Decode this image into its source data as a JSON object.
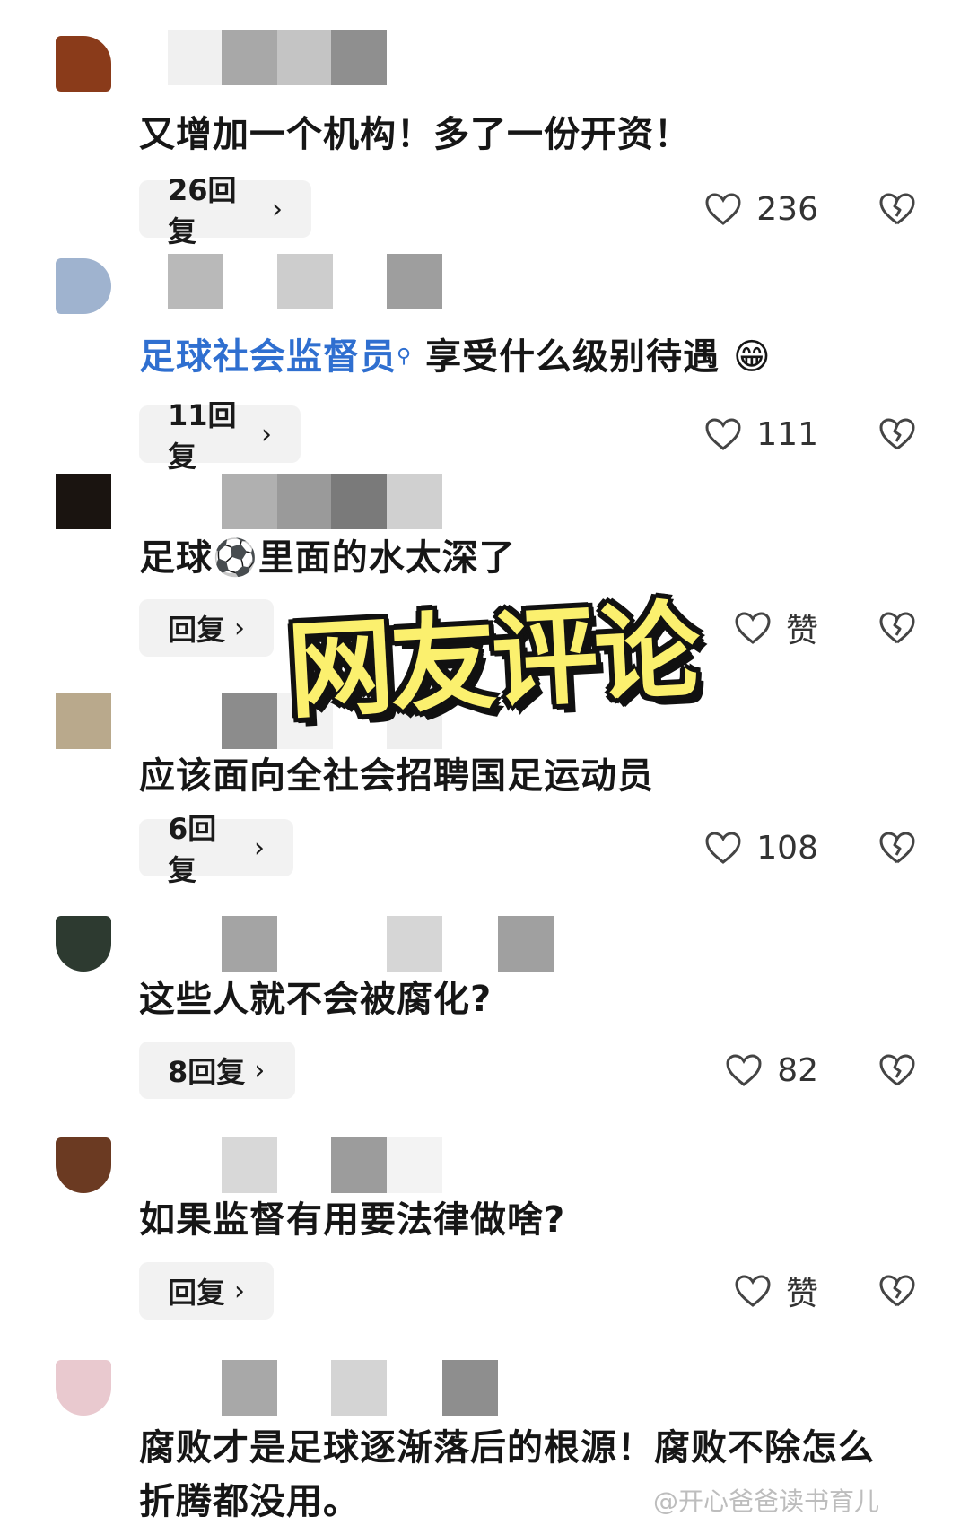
{
  "comments": [
    {
      "text": "又增加一个机构！多了一份开资！",
      "reply_label": "26回复",
      "like_label": "236",
      "avatar_color": "#8a3b1a"
    },
    {
      "text_link": "足球社会监督员",
      "text_rest": "享受什么级别待遇",
      "reply_label": "11回复",
      "like_label": "111",
      "avatar_color": "#9fb3cf"
    },
    {
      "text_a": "足球",
      "text_b": "里面的水太深了",
      "reply_label": "回复",
      "like_label": "赞",
      "avatar_color": "#1a1410"
    },
    {
      "text": "应该面向全社会招聘国足运动员",
      "reply_label": "6回复",
      "like_label": "108",
      "avatar_color": "#b9a98c"
    },
    {
      "text": "这些人就不会被腐化?",
      "reply_label": "8回复",
      "like_label": "82",
      "avatar_color": "#2d3a30"
    },
    {
      "text": "如果监督有用要法律做啥?",
      "reply_label": "回复",
      "like_label": "赞",
      "avatar_color": "#6b3a22"
    },
    {
      "text_line1": "腐败才是足球逐渐落后的根源！腐败不除怎么",
      "text_line2": "折腾都没用。",
      "avatar_color": "#e9c9cf"
    }
  ],
  "overlay_title": "网友评论",
  "watermark": "@开心爸爸读书育儿",
  "icons": {
    "like": "heart-icon",
    "dislike": "broken-heart-icon",
    "reply": "chevron-right-icon",
    "search": "search-icon",
    "emoji": "grinning-emoji",
    "ball": "soccer-ball-emoji"
  }
}
